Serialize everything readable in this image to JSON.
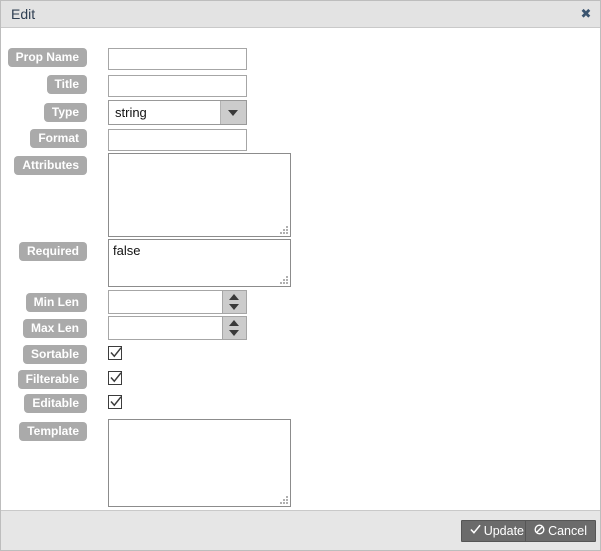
{
  "window": {
    "title": "Edit",
    "close_icon": "close-icon",
    "close_glyph": "✖"
  },
  "form": {
    "fields": [
      {
        "label": "Prop Name",
        "type": "text",
        "value": "",
        "placeholder": ""
      },
      {
        "label": "Title",
        "type": "text",
        "value": "",
        "placeholder": ""
      },
      {
        "label": "Type",
        "type": "select",
        "value": "string",
        "options": [
          "string"
        ]
      },
      {
        "label": "Format",
        "type": "text",
        "value": "",
        "placeholder": ""
      },
      {
        "label": "Attributes",
        "type": "textarea",
        "value": ""
      },
      {
        "label": "Required",
        "type": "textarea",
        "value": "false"
      },
      {
        "label": "Min Len",
        "type": "spinner",
        "value": "",
        "placeholder": ""
      },
      {
        "label": "Max Len",
        "type": "spinner",
        "value": "",
        "placeholder": ""
      },
      {
        "label": "Sortable",
        "type": "checkbox",
        "checked": true
      },
      {
        "label": "Filterable",
        "type": "checkbox",
        "checked": true
      },
      {
        "label": "Editable",
        "type": "checkbox",
        "checked": true
      },
      {
        "label": "Template",
        "type": "textarea",
        "value": ""
      }
    ]
  },
  "footer": {
    "update_label": "Update",
    "update_icon": "check-icon",
    "cancel_label": "Cancel",
    "cancel_icon": "no-entry-icon"
  },
  "colors": {
    "label_badge": "#aaaaaa",
    "titlebar": "#e3e3e3",
    "footer": "#e6e6e6",
    "button": "#6b6b6b",
    "dialog_border": "#bdbdbd",
    "title_text": "#2f3f52"
  }
}
